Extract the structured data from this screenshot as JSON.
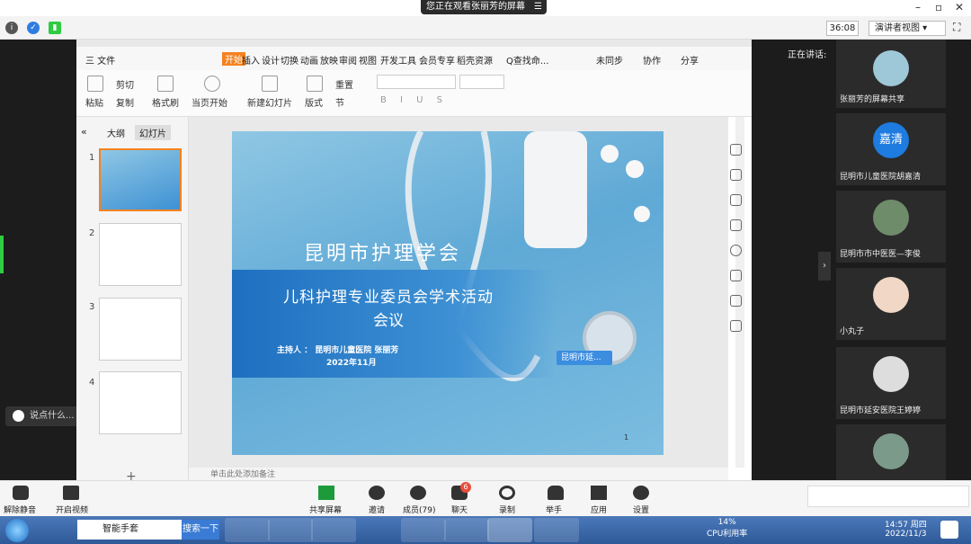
{
  "top": {
    "sharing": "您正在观看张丽芳的屏幕",
    "timer": "36:08",
    "presenter_view": "演讲者视图"
  },
  "wps": {
    "menu": [
      "三 文件",
      "开始",
      "插入",
      "设计",
      "切换",
      "动画",
      "放映",
      "审阅",
      "视图",
      "开发工具",
      "会员专享",
      "稻壳资源",
      "Q查找命..."
    ],
    "menu_right": [
      "未同步",
      "协作",
      "分享"
    ],
    "ribbon": [
      "粘贴",
      "剪切",
      "复制",
      "格式刷",
      "当页开始",
      "新建幻灯片",
      "版式",
      "重置",
      "节"
    ],
    "panel_tabs": [
      "大纲",
      "幻灯片"
    ],
    "thumb_nums": [
      "1",
      "2",
      "3",
      "4"
    ],
    "notes": "单击此处添加备注"
  },
  "slide": {
    "title": "昆明市护理学会",
    "subtitle1": "儿科护理专业委员会学术活动",
    "subtitle2": "会议",
    "host": "主持人 ： 昆明市儿童医院 张丽芳",
    "date": "2022年11月",
    "page": "1",
    "tooltip": "昆明市延..."
  },
  "left": {
    "chat_placeholder": "说点什么..."
  },
  "right": {
    "speaking": "正在讲话:",
    "participants": [
      "张丽芳的屏幕共享",
      "昆明市儿童医院胡嘉清",
      "昆明市市中医医—李俊",
      "小丸子",
      "昆明市延安医院王婷婷"
    ],
    "avatar_text": "嘉清"
  },
  "bottom": {
    "mute": "解除静音",
    "video": "开启视频",
    "share": "共享屏幕",
    "invite": "邀请",
    "members": "成员(79)",
    "chat": "聊天",
    "chat_badge": "6",
    "record": "录制",
    "raise": "举手",
    "apps": "应用",
    "settings": "设置"
  },
  "taskbar": {
    "app1": "智能手套",
    "search_btn": "搜索一下",
    "cpu": "14%",
    "cpu_label": "CPU利用率",
    "time": "14:57 周四",
    "date": "2022/11/3"
  }
}
